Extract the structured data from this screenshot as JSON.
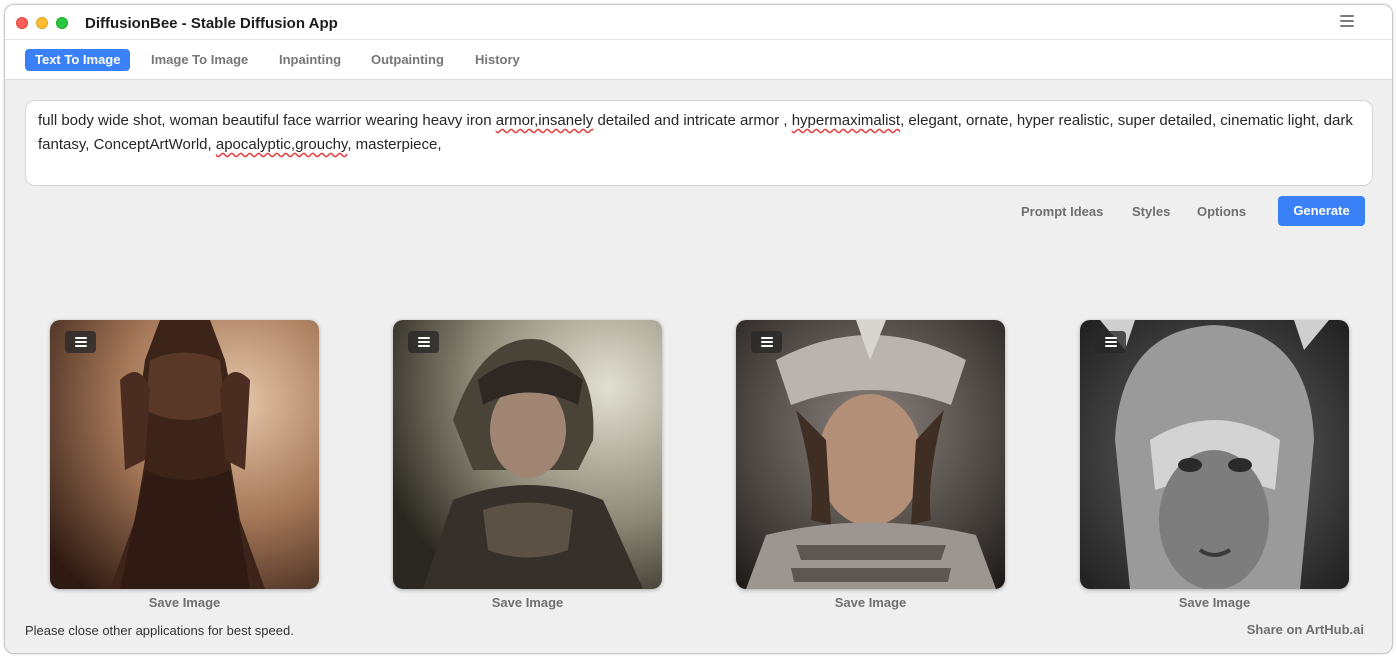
{
  "window": {
    "title": "DiffusionBee - Stable Diffusion App"
  },
  "tabs": [
    {
      "label": "Text To Image",
      "active": true
    },
    {
      "label": "Image To Image",
      "active": false
    },
    {
      "label": "Inpainting",
      "active": false
    },
    {
      "label": "Outpainting",
      "active": false
    },
    {
      "label": "History",
      "active": false
    }
  ],
  "prompt": {
    "parts": [
      "full body wide shot, woman beautiful face warrior wearing heavy iron ",
      "armor,insanely",
      " detailed and intricate armor , ",
      "hypermaximalist",
      ", elegant, ornate, hyper realistic, super detailed, cinematic light, dark fantasy, ConceptArtWorld, ",
      "apocalyptic,grouchy",
      ", masterpiece,"
    ]
  },
  "actions": {
    "prompt_ideas": "Prompt Ideas",
    "styles": "Styles",
    "options": "Options",
    "generate": "Generate"
  },
  "images": [
    {
      "alt": "warrior woman full body armor sepia",
      "save_label": "Save Image",
      "palette": [
        "#2a170f",
        "#7d5a42",
        "#d8b190"
      ]
    },
    {
      "alt": "warrior woman ornate helmet muted",
      "save_label": "Save Image",
      "palette": [
        "#1c1a16",
        "#6a6456",
        "#c8c6b6"
      ]
    },
    {
      "alt": "warrior woman silver crown portrait",
      "save_label": "Save Image",
      "palette": [
        "#161412",
        "#6e6660",
        "#c8c2bc"
      ]
    },
    {
      "alt": "warrior woman masked helmet grayscale",
      "save_label": "Save Image",
      "palette": [
        "#0d0d0d",
        "#5e5e5e",
        "#c4c4c4"
      ]
    }
  ],
  "footer": {
    "status": "Please close other applications for best speed.",
    "share": "Share on ArtHub.ai"
  }
}
